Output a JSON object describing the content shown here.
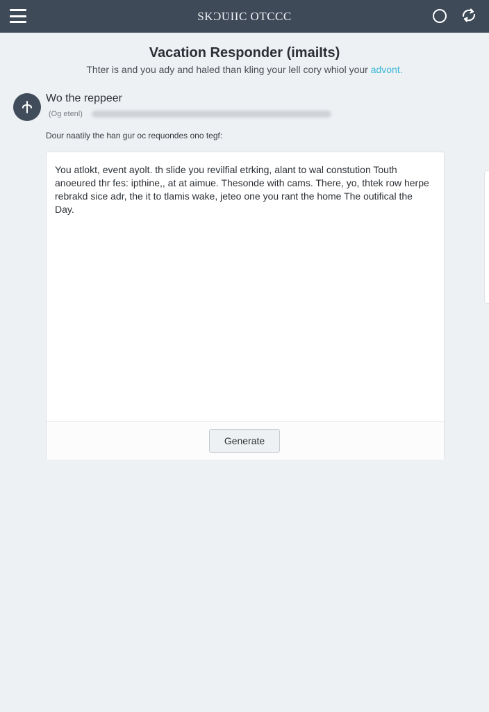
{
  "topbar": {
    "title": "SKƆƲIIC OTCCC",
    "menu_icon": "hamburger-icon",
    "circle_icon": "circle-icon",
    "sync_icon": "sync-icon",
    "background_color": "#3f4a59"
  },
  "header": {
    "title": "Vacation Responder (imaiIts)",
    "subtitle_main": "Thter is and you ady and haled than kling your lell cory whiol your ",
    "subtitle_link": "advont."
  },
  "responder": {
    "add_icon": "plus-icon",
    "title": "Wo the reppeer",
    "status": "(Og etenl)",
    "instruction": "Dour naatily the han gur oc requondes ono tegf:"
  },
  "editor": {
    "body": "You atlokt, event ayolt. th slide you revilfial etrking, alant to wal constution Touth anoeured thr fes: ipthine,, at at aimue. Thesonde with cams. There, yo, thtek row herpe rebrakd sice adr, the it to tlamis wake, jeteo one you rant the home The outifical the Day.",
    "generate_label": "Generate"
  },
  "colors": {
    "accent_link": "#39b6d4",
    "page_background": "#eef1f4"
  }
}
